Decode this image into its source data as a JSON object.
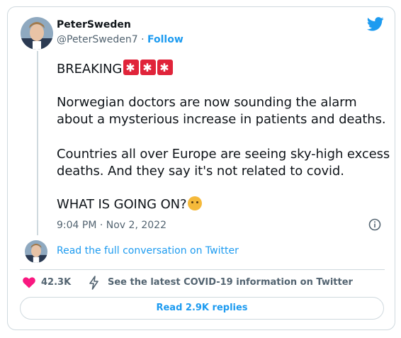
{
  "author": {
    "display_name": "PeterSweden",
    "handle": "@PeterSweden7",
    "separator": "·",
    "follow_label": "Follow"
  },
  "tweet": {
    "line1": "BREAKING",
    "line2": "Norwegian doctors are now sounding the alarm",
    "line3": "about a mysterious increase in patients and deaths.",
    "line4": "Countries all over Europe are seeing sky-high excess",
    "line5": "deaths. And they say it's not related to covid.",
    "line6": "WHAT IS GOING ON?",
    "emoji_breaking": "siren-emoji x3",
    "emoji_question": "thinking-face-emoji"
  },
  "timestamp": "9:04 PM · Nov 2, 2022",
  "read_conversation_label": "Read the full conversation on Twitter",
  "actions": {
    "likes": "42.3K",
    "covid_notice": "See the latest COVID-19 information on Twitter"
  },
  "replies_button": "Read 2.9K replies",
  "colors": {
    "accent": "#1d9bf0",
    "heart": "#f91880",
    "text": "#0f1419",
    "muted": "#536471",
    "border": "#cfd9de"
  },
  "icons": [
    "twitter-bird-icon",
    "info-icon",
    "heart-icon",
    "lightning-icon",
    "siren-emoji",
    "thinking-face-emoji"
  ]
}
